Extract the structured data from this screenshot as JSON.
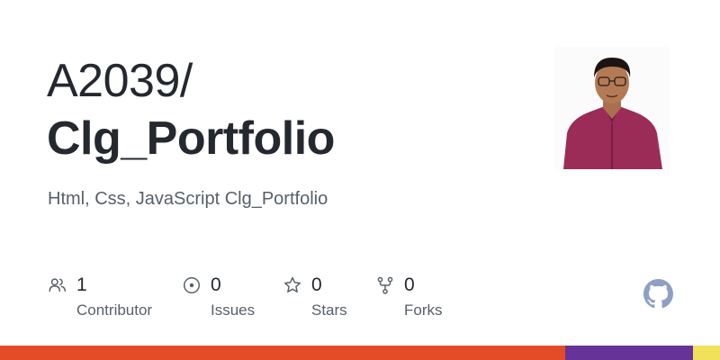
{
  "repo_card": {
    "owner": "A2039/",
    "name": "Clg_Portfolio",
    "description": "Html, Css, JavaScript Clg_Portfolio"
  },
  "stats": [
    {
      "icon": "people-icon",
      "value": "1",
      "label": "Contributor"
    },
    {
      "icon": "issue-icon",
      "value": "0",
      "label": "Issues"
    },
    {
      "icon": "star-icon",
      "value": "0",
      "label": "Stars"
    },
    {
      "icon": "fork-icon",
      "value": "0",
      "label": "Forks"
    }
  ],
  "logo": {
    "icon": "github-icon",
    "color": "#8fa0c4"
  },
  "language_bar": [
    {
      "color": "#e34c26",
      "fraction": 0.785
    },
    {
      "color": "#663399",
      "fraction": 0.177
    },
    {
      "color": "#f1e05a",
      "fraction": 0.038
    }
  ]
}
